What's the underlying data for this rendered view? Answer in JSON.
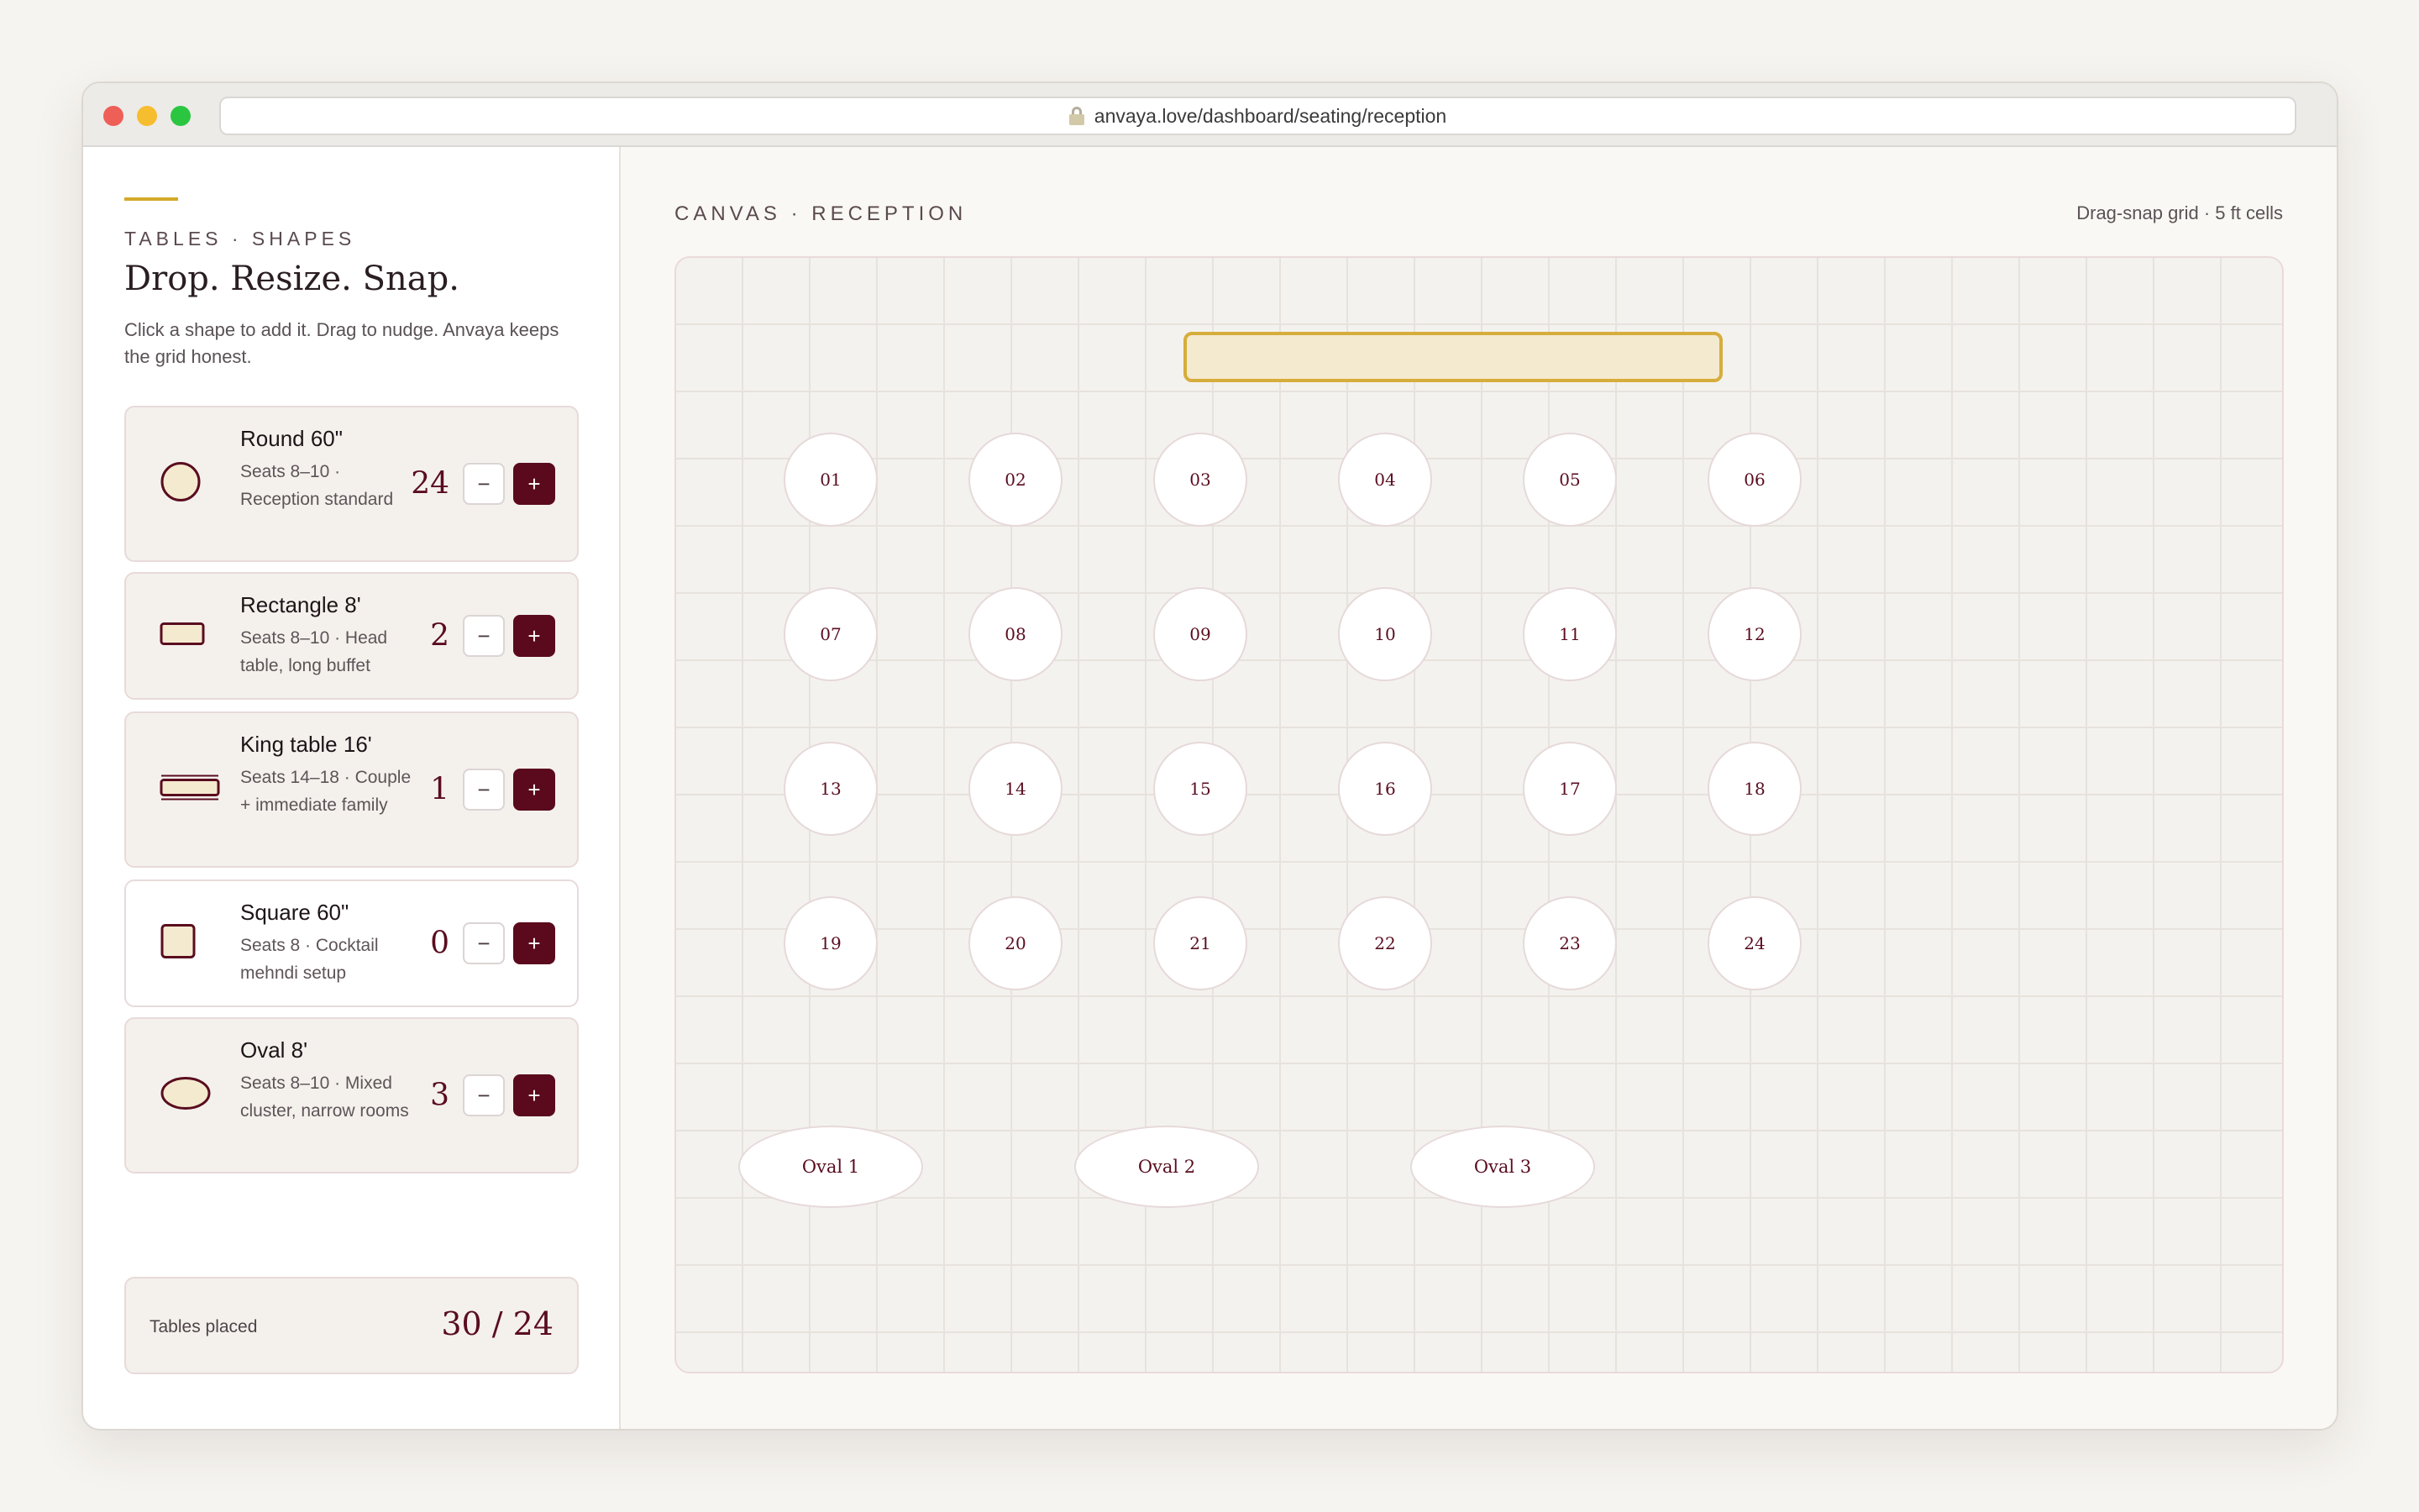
{
  "browser": {
    "url": "anvaya.love/dashboard/seating/reception"
  },
  "sidebar": {
    "eyebrow": "TABLES · SHAPES",
    "title": "Drop. Resize. Snap.",
    "description": "Click a shape to add it. Drag to nudge. Anvaya keeps the grid honest.",
    "shapes": [
      {
        "name": "Round 60\"",
        "description": "Seats 8–10 · Reception standard",
        "count": "24",
        "minus": "−",
        "plus": "+"
      },
      {
        "name": "Rectangle 8'",
        "description": "Seats 8–10 · Head table, long buffet",
        "count": "2",
        "minus": "−",
        "plus": "+"
      },
      {
        "name": "King table 16'",
        "description": "Seats 14–18 · Couple + immediate family",
        "count": "1",
        "minus": "−",
        "plus": "+"
      },
      {
        "name": "Square 60\"",
        "description": "Seats 8 · Cocktail mehndi setup",
        "count": "0",
        "minus": "−",
        "plus": "+"
      },
      {
        "name": "Oval 8'",
        "description": "Seats 8–10 · Mixed cluster, narrow rooms",
        "count": "3",
        "minus": "−",
        "plus": "+"
      }
    ],
    "summary": {
      "label": "Tables placed",
      "value": "30 / 24"
    }
  },
  "canvas": {
    "title": "CANVAS · RECEPTION",
    "grid_note": "Drag-snap grid · 5 ft cells",
    "round_tables": [
      "01",
      "02",
      "03",
      "04",
      "05",
      "06",
      "07",
      "08",
      "09",
      "10",
      "11",
      "12",
      "13",
      "14",
      "15",
      "16",
      "17",
      "18",
      "19",
      "20",
      "21",
      "22",
      "23",
      "24"
    ],
    "oval_tables": [
      "Oval 1",
      "Oval 2",
      "Oval 3"
    ]
  },
  "colors": {
    "accent_gold": "#d3a928",
    "brand_burgundy": "#5a0a1c",
    "head_table_fill": "#f4ead0"
  },
  "icons": [
    "lock-icon",
    "round-table-icon",
    "rectangle-table-icon",
    "king-table-icon",
    "square-table-icon",
    "oval-table-icon"
  ]
}
